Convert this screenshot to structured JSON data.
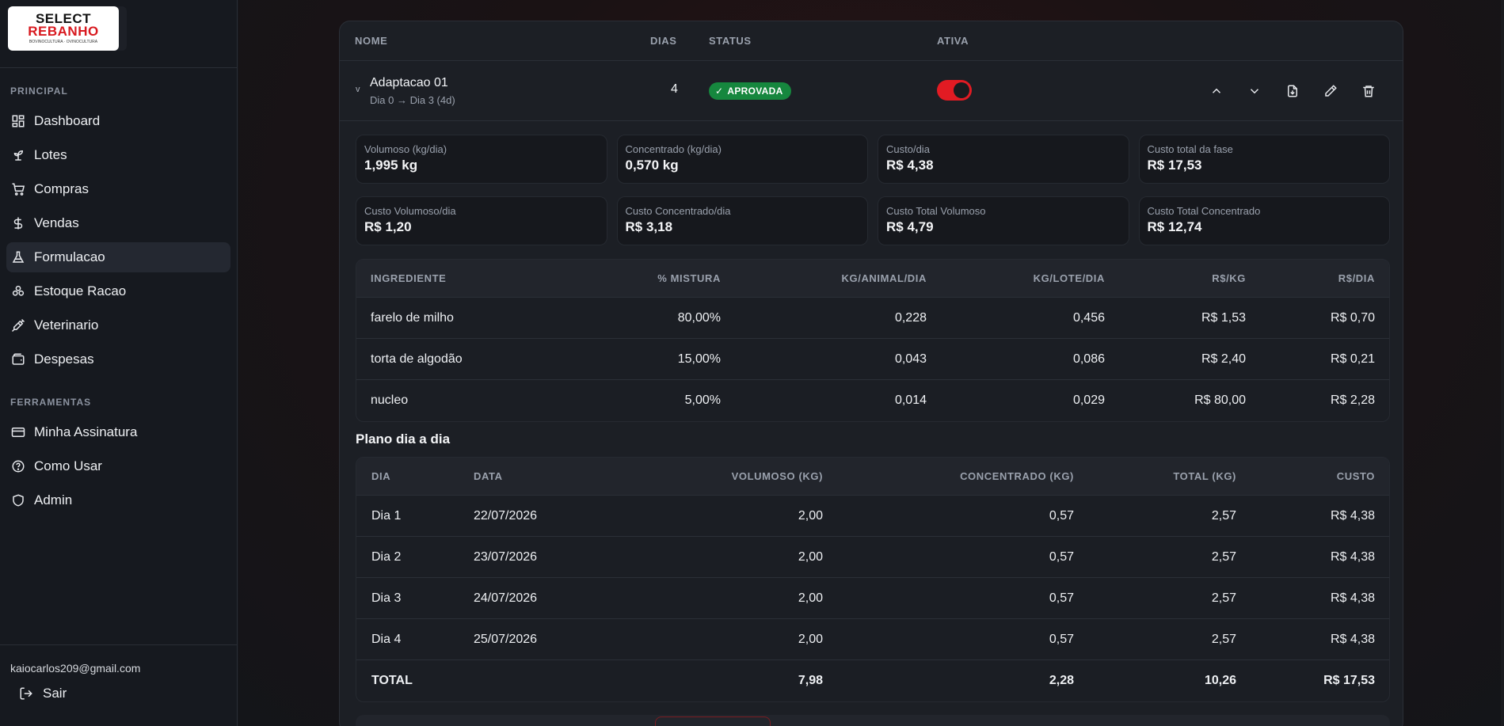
{
  "logo": {
    "line1": "SELECT",
    "line2": "REBANHO",
    "tagline": "BOVINOCULTURA · OVINOCULTURA"
  },
  "sidebar": {
    "section_principal": "PRINCIPAL",
    "items": [
      {
        "label": "Dashboard",
        "icon": "dashboard-icon"
      },
      {
        "label": "Lotes",
        "icon": "sprout-icon"
      },
      {
        "label": "Compras",
        "icon": "cart-icon"
      },
      {
        "label": "Vendas",
        "icon": "dollar-icon"
      },
      {
        "label": "Formulacao",
        "icon": "flask-icon",
        "active": true
      },
      {
        "label": "Estoque Racao",
        "icon": "stack-icon"
      },
      {
        "label": "Veterinario",
        "icon": "syringe-icon"
      },
      {
        "label": "Despesas",
        "icon": "wallet-icon"
      }
    ],
    "section_ferramentas": "FERRAMENTAS",
    "tools": [
      {
        "label": "Minha Assinatura",
        "icon": "credit-card-icon"
      },
      {
        "label": "Como Usar",
        "icon": "help-icon"
      },
      {
        "label": "Admin",
        "icon": "shield-icon"
      }
    ],
    "email": "kaiocarlos209@gmail.com",
    "logout": "Sair"
  },
  "phases_table": {
    "headers": {
      "name": "NOME",
      "days": "DIAS",
      "status": "STATUS",
      "active": "ATIVA"
    },
    "phase": {
      "name": "Adaptacao 01",
      "subtitle": "Dia 0 → Dia 3 (4d)",
      "days": "4",
      "status": "APROVADA",
      "active": true,
      "chevron": "v"
    }
  },
  "stats": [
    {
      "label": "Volumoso (kg/dia)",
      "value": "1,995 kg"
    },
    {
      "label": "Concentrado (kg/dia)",
      "value": "0,570 kg"
    },
    {
      "label": "Custo/dia",
      "value": "R$ 4,38"
    },
    {
      "label": "Custo total da fase",
      "value": "R$ 17,53"
    },
    {
      "label": "Custo Volumoso/dia",
      "value": "R$ 1,20"
    },
    {
      "label": "Custo Concentrado/dia",
      "value": "R$ 3,18"
    },
    {
      "label": "Custo Total Volumoso",
      "value": "R$ 4,79"
    },
    {
      "label": "Custo Total Concentrado",
      "value": "R$ 12,74"
    }
  ],
  "ingredients": {
    "headers": [
      "INGREDIENTE",
      "% MISTURA",
      "KG/ANIMAL/DIA",
      "KG/LOTE/DIA",
      "R$/KG",
      "R$/DIA"
    ],
    "rows": [
      [
        "farelo de milho",
        "80,00%",
        "0,228",
        "0,456",
        "R$ 1,53",
        "R$ 0,70"
      ],
      [
        "torta de algodão",
        "15,00%",
        "0,043",
        "0,086",
        "R$ 2,40",
        "R$ 0,21"
      ],
      [
        "nucleo",
        "5,00%",
        "0,014",
        "0,029",
        "R$ 80,00",
        "R$ 2,28"
      ]
    ]
  },
  "plan": {
    "title": "Plano dia a dia",
    "headers": [
      "DIA",
      "DATA",
      "VOLUMOSO (KG)",
      "CONCENTRADO (KG)",
      "TOTAL (KG)",
      "CUSTO"
    ],
    "rows": [
      [
        "Dia 1",
        "22/07/2026",
        "2,00",
        "0,57",
        "2,57",
        "R$ 4,38"
      ],
      [
        "Dia 2",
        "23/07/2026",
        "2,00",
        "0,57",
        "2,57",
        "R$ 4,38"
      ],
      [
        "Dia 3",
        "24/07/2026",
        "2,00",
        "0,57",
        "2,57",
        "R$ 4,38"
      ],
      [
        "Dia 4",
        "25/07/2026",
        "2,00",
        "0,57",
        "2,57",
        "R$ 4,38"
      ]
    ],
    "total": [
      "TOTAL",
      "",
      "7,98",
      "2,28",
      "10,26",
      "R$ 17,53"
    ]
  },
  "colors": {
    "accent": "#e21b23",
    "approved": "#16873e",
    "background": "#15171c",
    "card": "#1c1f25"
  }
}
